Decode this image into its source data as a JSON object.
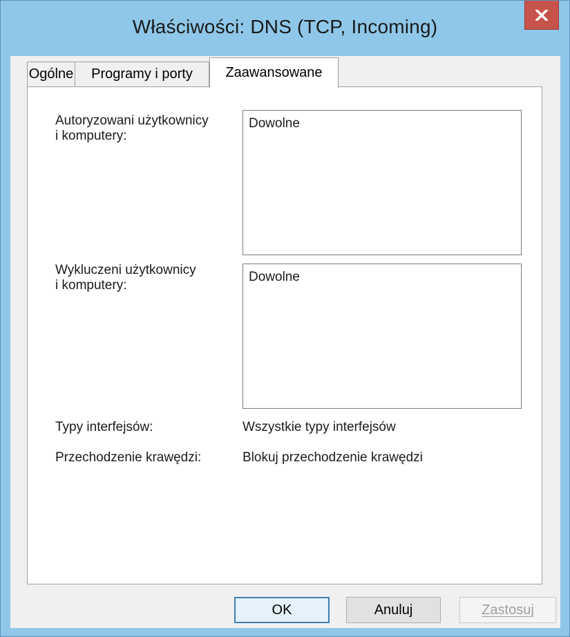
{
  "window": {
    "title": "Właściwości: DNS (TCP, Incoming)"
  },
  "tabs": [
    {
      "label": "Ogólne"
    },
    {
      "label": "Programy i porty"
    },
    {
      "label": "Zaawansowane"
    }
  ],
  "advanced": {
    "authorized_label": "Autoryzowani użytkownicy\ni komputery:",
    "authorized_items": [
      "Dowolne"
    ],
    "excluded_label": "Wykluczeni użytkownicy\ni komputery:",
    "excluded_items": [
      "Dowolne"
    ],
    "interface_types_label": "Typy interfejsów:",
    "interface_types_value": "Wszystkie typy interfejsów",
    "edge_traversal_label": "Przechodzenie krawędzi:",
    "edge_traversal_value": "Blokuj przechodzenie krawędzi"
  },
  "buttons": {
    "ok": "OK",
    "cancel": "Anuluj",
    "apply": "Zastosuj"
  }
}
